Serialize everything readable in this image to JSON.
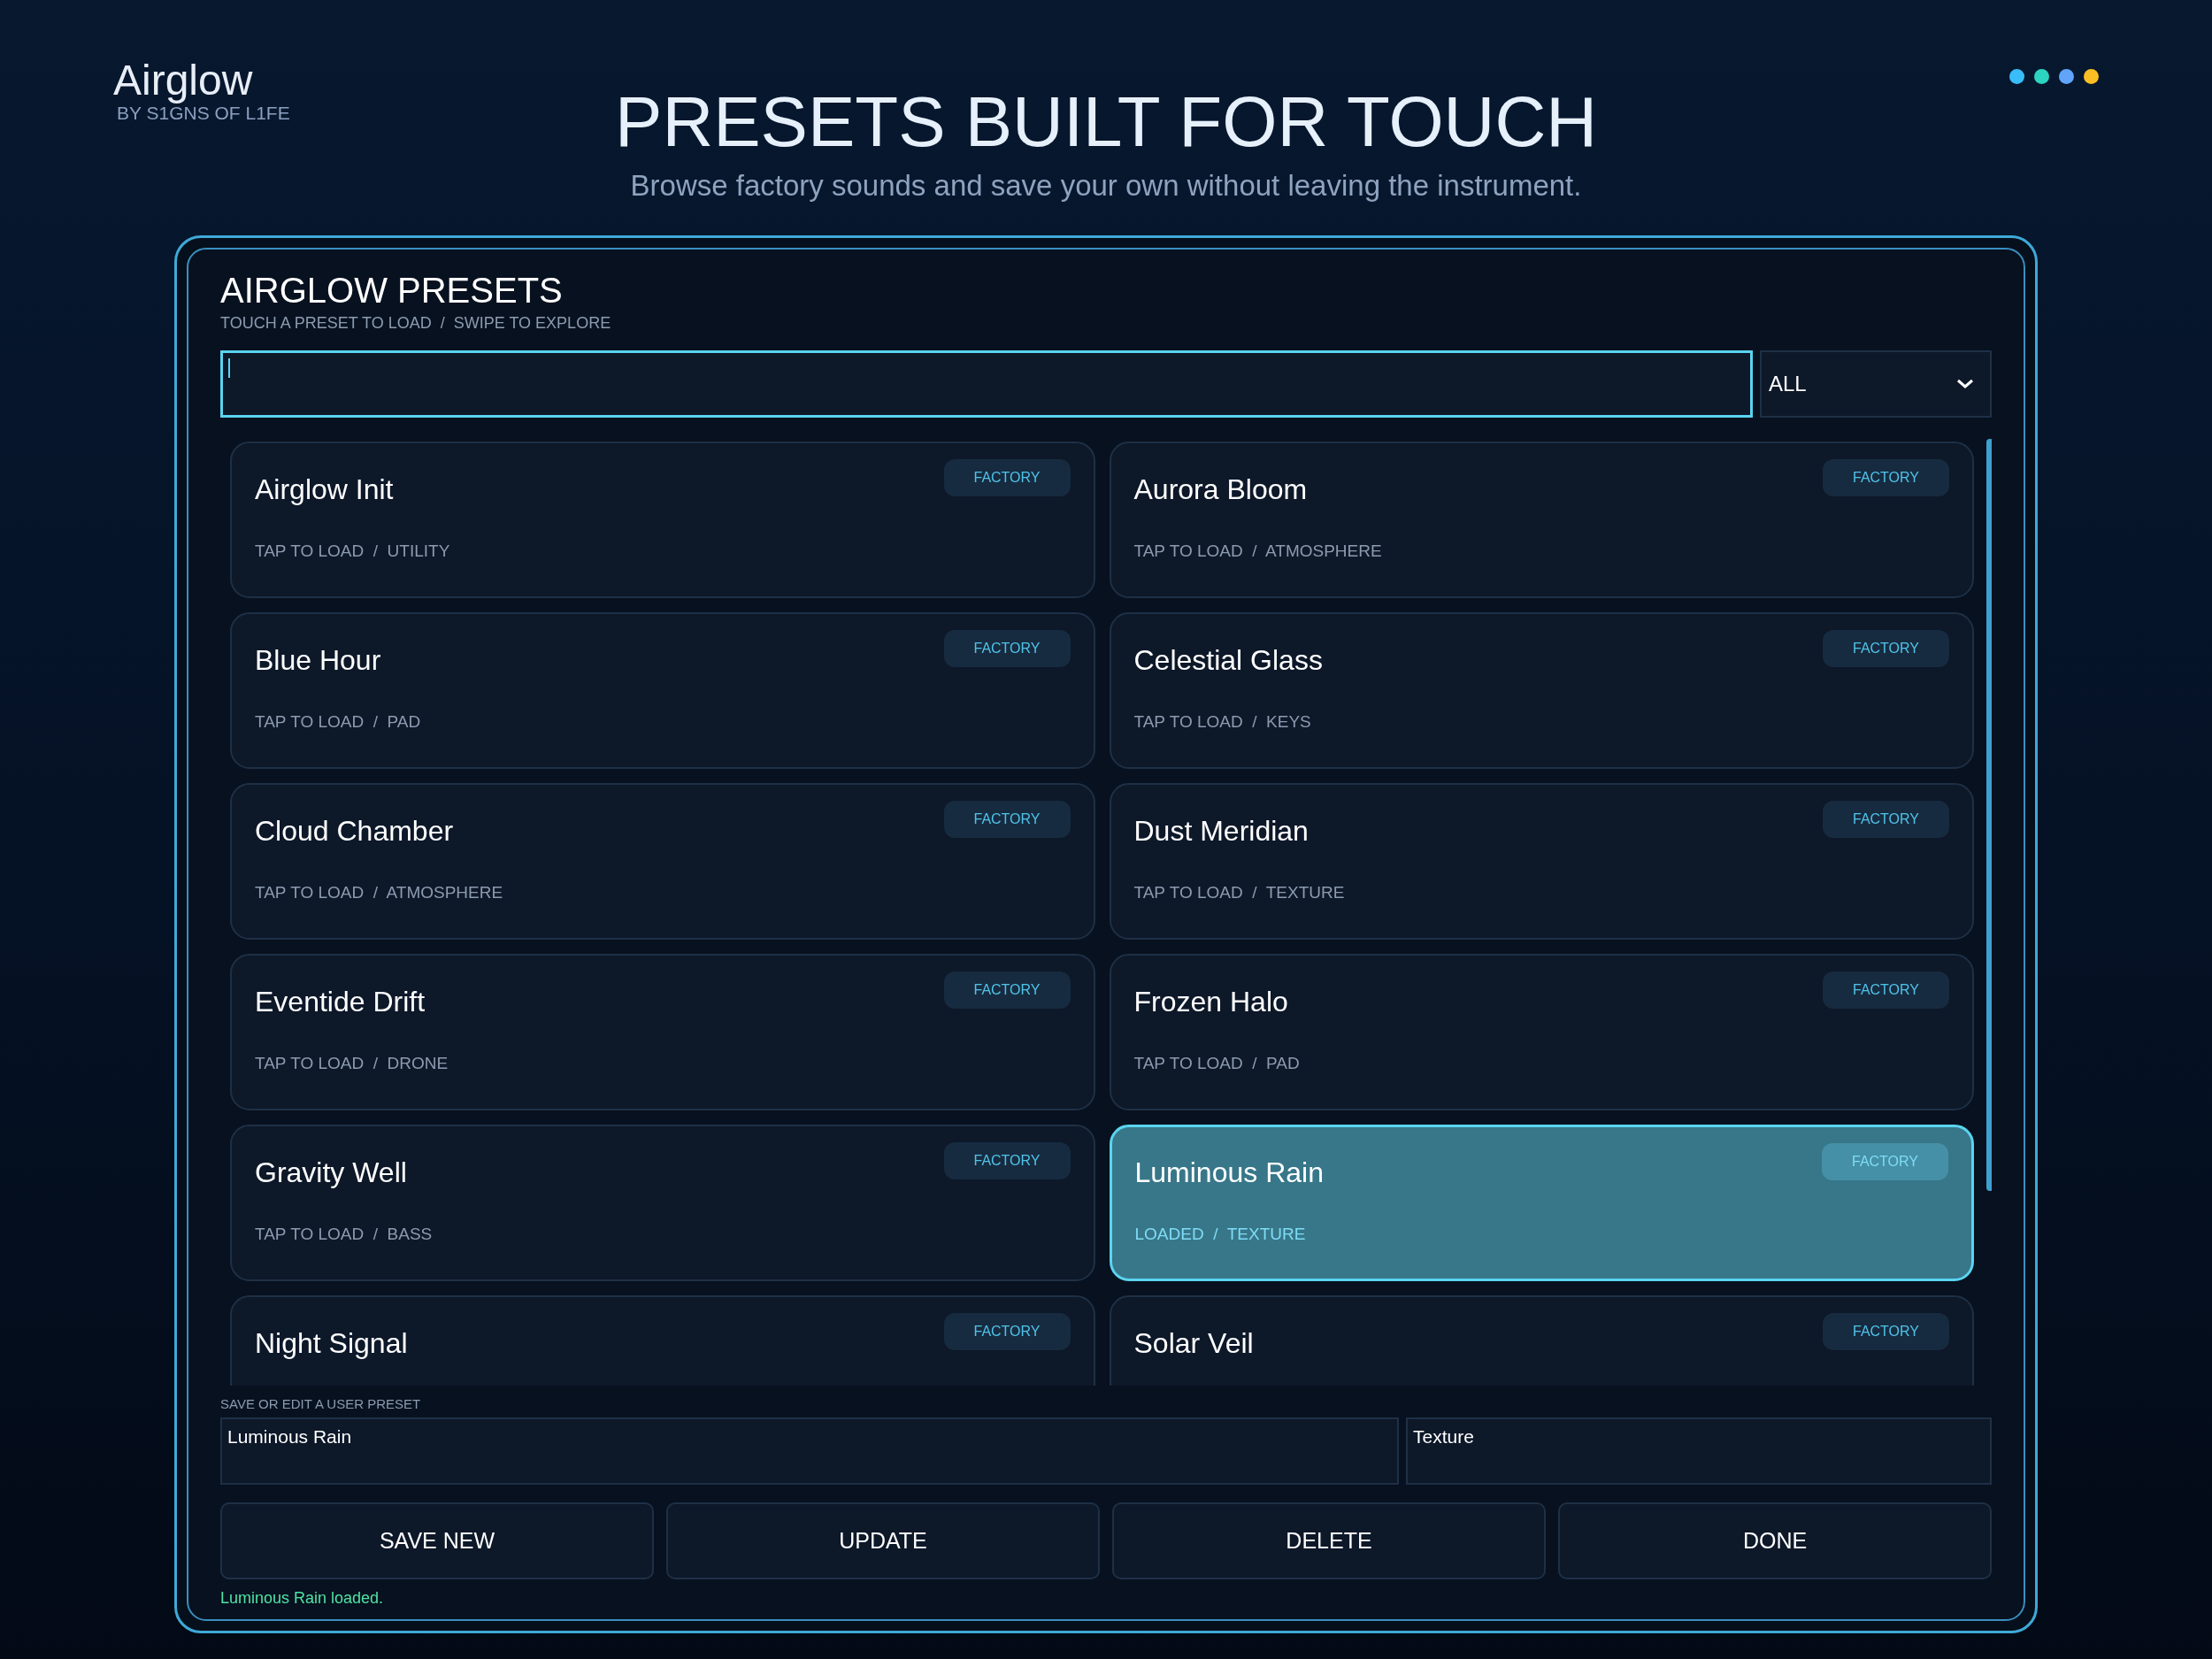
{
  "brand": {
    "name": "Airglow",
    "byline": "BY S1GNS OF L1FE"
  },
  "hero": {
    "title": "PRESETS BUILT FOR TOUCH",
    "subtitle": "Browse factory sounds and save your own without leaving the instrument."
  },
  "status_dots": [
    {
      "color": "#38bdf8"
    },
    {
      "color": "#2dd4bf"
    },
    {
      "color": "#60a5fa"
    },
    {
      "color": "#fbbf24"
    }
  ],
  "panel": {
    "title": "AIRGLOW PRESETS",
    "hint": "TOUCH A PRESET TO LOAD  /  SWIPE TO EXPLORE",
    "filter": {
      "value": "ALL"
    },
    "presets": [
      {
        "name": "Airglow Init",
        "badge": "FACTORY",
        "meta": "TAP TO LOAD  /  UTILITY",
        "selected": false
      },
      {
        "name": "Aurora Bloom",
        "badge": "FACTORY",
        "meta": "TAP TO LOAD  /  ATMOSPHERE",
        "selected": false
      },
      {
        "name": "Blue Hour",
        "badge": "FACTORY",
        "meta": "TAP TO LOAD  /  PAD",
        "selected": false
      },
      {
        "name": "Celestial Glass",
        "badge": "FACTORY",
        "meta": "TAP TO LOAD  /  KEYS",
        "selected": false
      },
      {
        "name": "Cloud Chamber",
        "badge": "FACTORY",
        "meta": "TAP TO LOAD  /  ATMOSPHERE",
        "selected": false
      },
      {
        "name": "Dust Meridian",
        "badge": "FACTORY",
        "meta": "TAP TO LOAD  /  TEXTURE",
        "selected": false
      },
      {
        "name": "Eventide Drift",
        "badge": "FACTORY",
        "meta": "TAP TO LOAD  /  DRONE",
        "selected": false
      },
      {
        "name": "Frozen Halo",
        "badge": "FACTORY",
        "meta": "TAP TO LOAD  /  PAD",
        "selected": false
      },
      {
        "name": "Gravity Well",
        "badge": "FACTORY",
        "meta": "TAP TO LOAD  /  BASS",
        "selected": false
      },
      {
        "name": "Luminous Rain",
        "badge": "FACTORY",
        "meta": "LOADED  /  TEXTURE",
        "selected": true
      },
      {
        "name": "Night Signal",
        "badge": "FACTORY",
        "selected": false
      },
      {
        "name": "Solar Veil",
        "badge": "FACTORY",
        "selected": false
      }
    ],
    "editor": {
      "label": "SAVE OR EDIT A USER PRESET",
      "name_value": "Luminous Rain",
      "category_value": "Texture"
    },
    "buttons": [
      "SAVE NEW",
      "UPDATE",
      "DELETE",
      "DONE"
    ],
    "status": "Luminous Rain loaded."
  }
}
